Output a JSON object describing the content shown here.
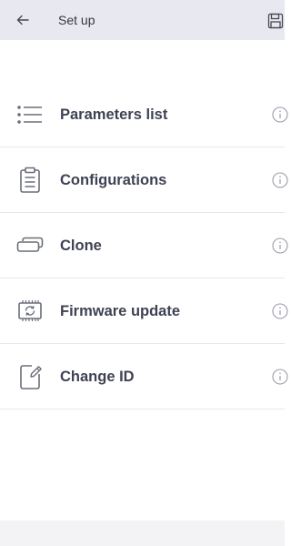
{
  "app_bar": {
    "title": "Set up",
    "back_icon": "arrow-left-icon",
    "save_icon": "floppy-disk-icon"
  },
  "menu": {
    "items": [
      {
        "label": "Parameters list",
        "icon": "list-icon"
      },
      {
        "label": "Configurations",
        "icon": "clipboard-icon"
      },
      {
        "label": "Clone",
        "icon": "clone-cards-icon"
      },
      {
        "label": "Firmware update",
        "icon": "chip-refresh-icon"
      },
      {
        "label": "Change ID",
        "icon": "edit-document-icon"
      }
    ],
    "info_icon": "info-icon"
  },
  "colors": {
    "app_bar_bg": "#e8e9f0",
    "label_text": "#3f4254",
    "icon_stroke": "#6b6e7a",
    "divider": "#e7e8ec"
  }
}
